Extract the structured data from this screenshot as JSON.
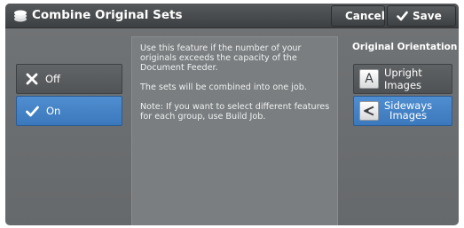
{
  "header": {
    "title": "Combine Original Sets",
    "cancel_label": "Cancel",
    "save_label": "Save"
  },
  "options": {
    "off_label": "Off",
    "on_label": "On",
    "selected": "On"
  },
  "info": {
    "paragraph1": "Use this feature if the number of your originals exceeds the capacity of the Document Feeder.",
    "paragraph2": "The sets will be combined into one job.",
    "paragraph3": "Note: If you want to select different features for each group, use Build Job."
  },
  "orientation": {
    "heading": "Original Orientation",
    "upright_label": "Upright Images",
    "sideways_line1": "Sideways",
    "sideways_line2": "Images",
    "selected": "Sideways Images"
  },
  "colors": {
    "selected_blue": "#4a88c9",
    "panel_gray": "#6d7072"
  }
}
